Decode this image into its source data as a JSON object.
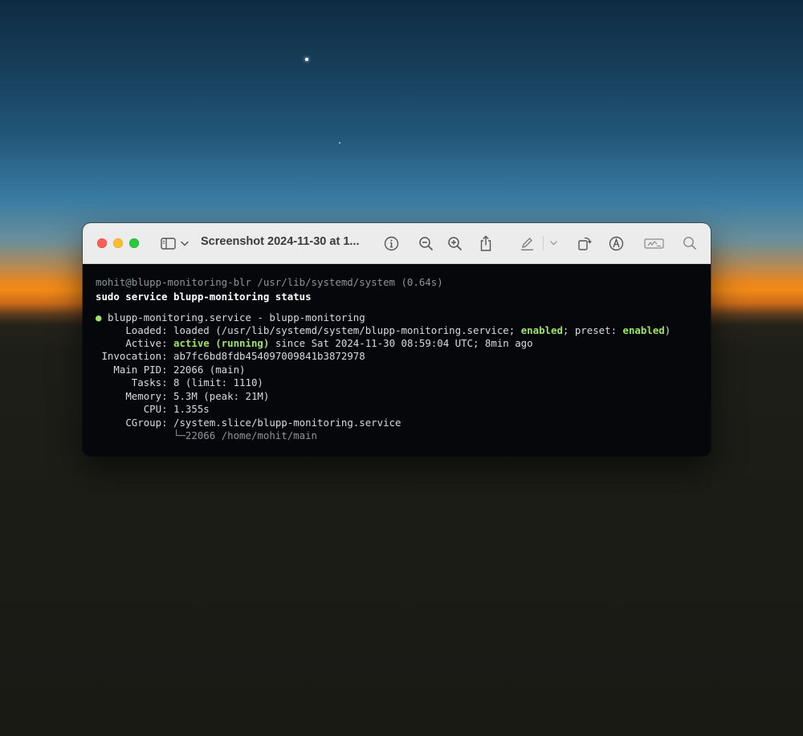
{
  "window": {
    "title": "Screenshot 2024-11-30 at 1..."
  },
  "icons": {
    "sidebar": "sidebar-icon",
    "chevron": "chevron-down-icon",
    "info": "info-icon",
    "zoom_out": "zoom-out-icon",
    "zoom_in": "zoom-in-icon",
    "share": "share-icon",
    "markup": "pen-icon",
    "rotate": "rotate-icon",
    "annotate": "markup-icon",
    "sign": "signature-icon",
    "search": "search-icon"
  },
  "terminal": {
    "prompt": "mohit@blupp-monitoring-blr /usr/lib/systemd/system (0.64s)",
    "command": "sudo service blupp-monitoring status",
    "service_bullet": "●",
    "service_line": "blupp-monitoring.service - blupp-monitoring",
    "loaded_label": "Loaded:",
    "loaded_value_1": "loaded (/usr/lib/systemd/system/blupp-monitoring.service;",
    "loaded_enabled": "enabled",
    "loaded_value_2": "; preset:",
    "loaded_preset": "enabled",
    "loaded_value_3": ")",
    "active_label": "Active:",
    "active_state": "active (running)",
    "active_since": "since Sat 2024-11-30 08:59:04 UTC; 8min ago",
    "invocation_label": "Invocation:",
    "invocation_value": "ab7fc6bd8fdb454097009841b3872978",
    "pid_label": "Main PID:",
    "pid_value": "22066 (main)",
    "tasks_label": "Tasks:",
    "tasks_value": "8 (limit: 1110)",
    "memory_label": "Memory:",
    "memory_value": "5.3M (peak: 21M)",
    "cpu_label": "CPU:",
    "cpu_value": "1.355s",
    "cgroup_label": "CGroup:",
    "cgroup_value": "/system.slice/blupp-monitoring.service",
    "tree_branch": "└─",
    "tree_value": "22066 /home/mohit/main"
  },
  "colors": {
    "accent_green": "#9ee36a",
    "terminal_bg": "#05070a",
    "titlebar_bg": "#ececec"
  }
}
